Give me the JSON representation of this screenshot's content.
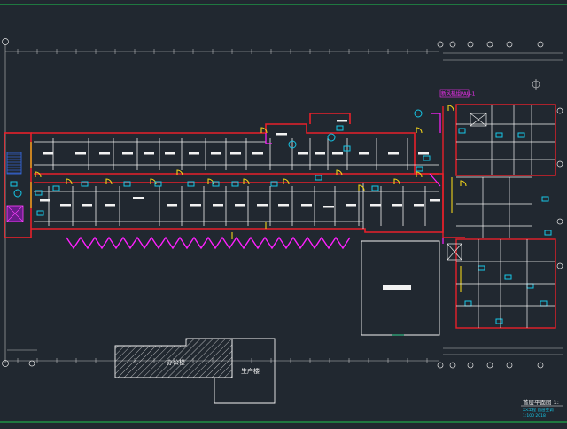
{
  "drawing": {
    "background": "#212830",
    "colors": {
      "wall": "#e8202a",
      "partition": "#f2f2f2",
      "door": "#f0d21a",
      "duct": "#ff20ff",
      "equipment": "#16c8e8",
      "dimension": "#d9d9d9",
      "label_magenta": "#ff30ff",
      "sheet_border": "#1fa84a"
    },
    "labels": {
      "building_a": "办公楼",
      "building_b": "生产楼",
      "ahu_tag": "新风机组PAU-1",
      "sheet_title": "首层平面图 1:",
      "sheet_note_1": "XX工程 首层空调",
      "sheet_note_2": "1:100 2018"
    },
    "icons": [
      "grid-bubble-icon",
      "stair-icon",
      "equipment-icon",
      "north-arrow-icon"
    ]
  }
}
